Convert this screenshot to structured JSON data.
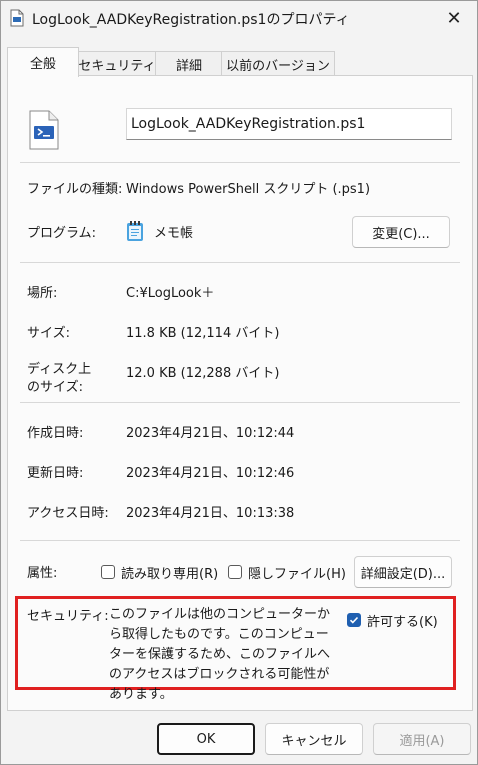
{
  "window": {
    "title": "LogLook_AADKeyRegistration.ps1のプロパティ",
    "close_glyph": "✕"
  },
  "tabs": [
    {
      "label": "全般",
      "active": true
    },
    {
      "label": "セキュリティ"
    },
    {
      "label": "詳細"
    },
    {
      "label": "以前のバージョン"
    }
  ],
  "general": {
    "filename": "LogLook_AADKeyRegistration.ps1",
    "file_type_label": "ファイルの種類:",
    "file_type_value": "Windows PowerShell スクリプト (.ps1)",
    "program_label": "プログラム:",
    "program_value": "メモ帳",
    "change_button": "変更(C)...",
    "location_label": "場所:",
    "location_value": "C:¥LogLook＋",
    "size_label": "サイズ:",
    "size_value": "11.8 KB (12,114 バイト)",
    "disk_size_label_1": "ディスク上",
    "disk_size_label_2": "のサイズ:",
    "disk_size_value": "12.0 KB (12,288 バイト)",
    "created_label": "作成日時:",
    "created_value": "2023年4月21日、10:12:44",
    "modified_label": "更新日時:",
    "modified_value": "2023年4月21日、10:12:46",
    "accessed_label": "アクセス日時:",
    "accessed_value": "2023年4月21日、10:13:38",
    "attributes_label": "属性:",
    "readonly_label": "読み取り専用(R)",
    "readonly_checked": false,
    "hidden_label": "隠しファイル(H)",
    "hidden_checked": false,
    "advanced_button": "詳細設定(D)...",
    "security_label": "セキュリティ:",
    "security_text": "このファイルは他のコンピューターから取得したものです。このコンピューターを保護するため、このファイルへのアクセスはブロックされる可能性があります。",
    "unblock_label": "許可する(K)",
    "unblock_checked": true
  },
  "footer": {
    "ok": "OK",
    "cancel": "キャンセル",
    "apply": "適用(A)"
  },
  "colors": {
    "highlight_border": "#e02020",
    "checkbox_accent": "#1f5fb0"
  }
}
